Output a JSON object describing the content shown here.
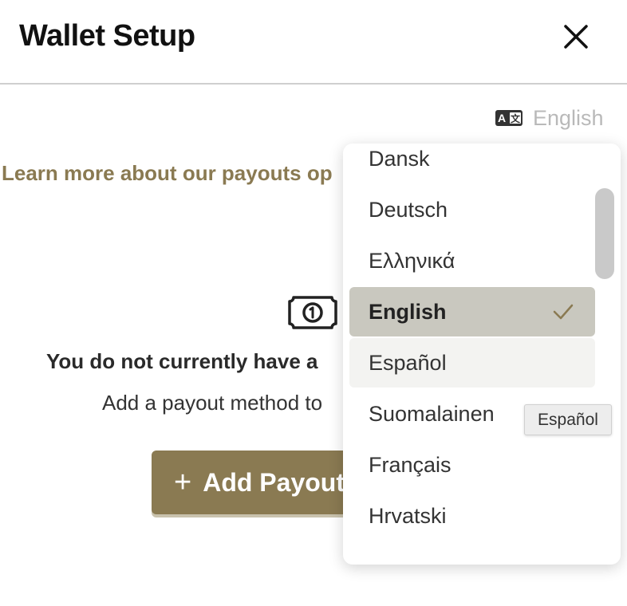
{
  "header": {
    "title": "Wallet Setup",
    "close_icon": "close-icon"
  },
  "language": {
    "icon": "translate-icon",
    "current": "English"
  },
  "learn_more": "Learn more about our payouts op",
  "empty_state": {
    "icon": "money-bill-icon",
    "title": "You do not currently have a",
    "subtitle": "Add a payout method to"
  },
  "add_button": {
    "label": "Add Payout",
    "icon": "plus-icon",
    "color": "#8a7a52"
  },
  "dropdown": {
    "options": [
      {
        "label": "Dansk",
        "state": "normal"
      },
      {
        "label": "Deutsch",
        "state": "normal"
      },
      {
        "label": "Ελληνικά",
        "state": "normal"
      },
      {
        "label": "English",
        "state": "selected"
      },
      {
        "label": "Español",
        "state": "hover"
      },
      {
        "label": "Suomalainen",
        "state": "normal"
      },
      {
        "label": "Français",
        "state": "normal"
      },
      {
        "label": "Hrvatski",
        "state": "normal"
      }
    ],
    "selected_color": "#c9c8bf",
    "check_icon": "checkmark-icon"
  },
  "tooltip": "Español"
}
